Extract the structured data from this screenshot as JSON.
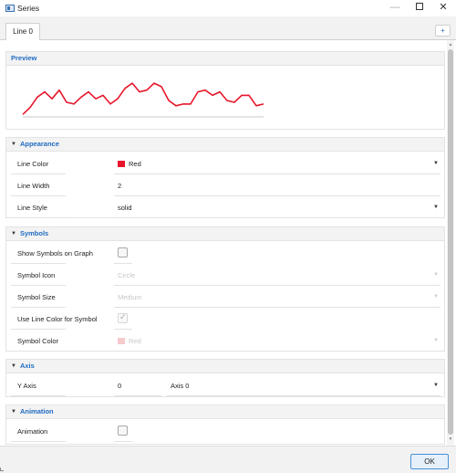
{
  "window": {
    "title": "Series",
    "min_glyph": "—",
    "close_glyph": "✕"
  },
  "tabs": {
    "items": [
      {
        "label": "Line 0"
      }
    ],
    "add_label": "+"
  },
  "preview": {
    "header": "Preview",
    "line_color": "#e8152b",
    "axis_color": "#c8c8c8",
    "points": [
      3,
      7,
      13,
      16,
      12,
      17,
      10,
      9,
      13,
      16,
      12,
      14,
      9,
      12,
      18,
      21,
      16,
      17,
      21,
      19,
      11,
      8,
      9,
      9,
      16,
      17,
      14,
      16,
      11,
      10,
      14,
      14,
      8,
      9
    ]
  },
  "appearance": {
    "header": "Appearance",
    "line_color_label": "Line Color",
    "line_color_value": "Red",
    "line_color_hex": "#e8152b",
    "line_width_label": "Line Width",
    "line_width_value": "2",
    "line_style_label": "Line Style",
    "line_style_value": "solid"
  },
  "symbols": {
    "header": "Symbols",
    "show_symbols_label": "Show Symbols on Graph",
    "show_symbols_checked": false,
    "symbol_icon_label": "Symbol Icon",
    "symbol_icon_value": "Circle",
    "symbol_size_label": "Symbol Size",
    "symbol_size_value": "Medium",
    "use_line_color_label": "Use Line Color for Symbol",
    "use_line_color_checked": true,
    "symbol_color_label": "Symbol Color",
    "symbol_color_value": "Red",
    "symbol_color_hex": "#f6c9cd"
  },
  "axis": {
    "header": "Axis",
    "y_axis_label": "Y Axis",
    "y_axis_index": "0",
    "y_axis_name": "Axis 0"
  },
  "animation": {
    "header": "Animation",
    "animation_label": "Animation",
    "animation_checked": false
  },
  "icons": {
    "collapse": "▼",
    "dropdown": "▼",
    "check": "✓",
    "scroll_up": "▲",
    "scroll_down": "▼"
  },
  "footer": {
    "ok_label": "OK"
  },
  "colors": {
    "accent": "#1f6cc0",
    "ok_border": "#4a90d9"
  }
}
